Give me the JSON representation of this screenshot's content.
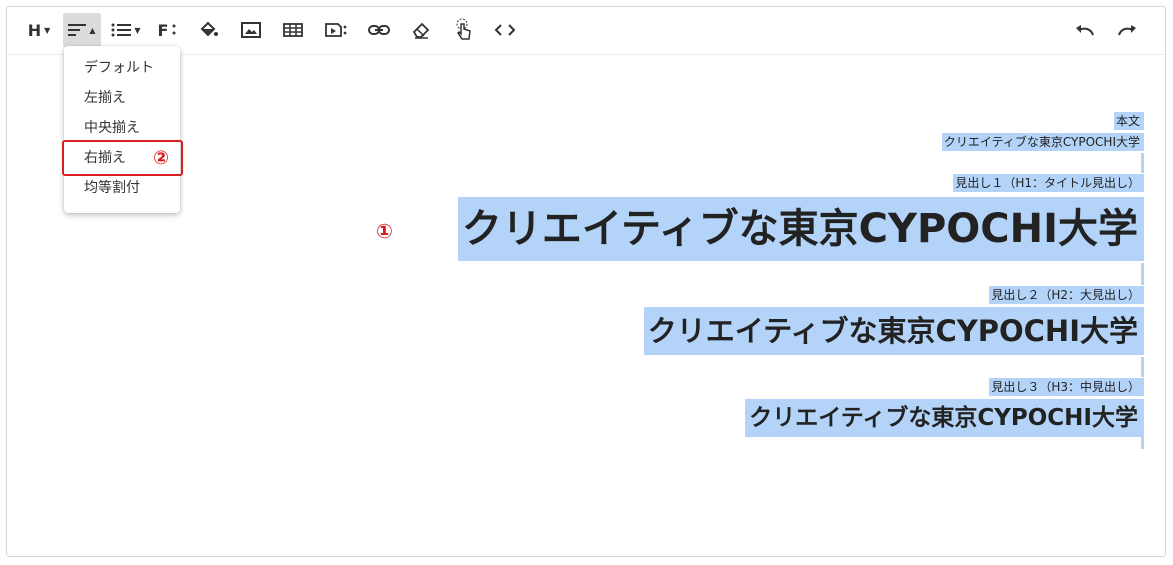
{
  "toolbar": {
    "heading_label": "H",
    "font_label": "F",
    "buttons": [
      {
        "icon": "heading-icon"
      },
      {
        "icon": "align-icon"
      },
      {
        "icon": "list-icon"
      },
      {
        "icon": "font-icon"
      },
      {
        "icon": "fill-color-icon"
      },
      {
        "icon": "image-icon"
      },
      {
        "icon": "table-icon"
      },
      {
        "icon": "media-icon"
      },
      {
        "icon": "link-icon"
      },
      {
        "icon": "eraser-icon"
      },
      {
        "icon": "touch-icon"
      },
      {
        "icon": "code-icon"
      },
      {
        "icon": "undo-icon"
      },
      {
        "icon": "redo-icon"
      }
    ]
  },
  "align_menu": {
    "items": [
      "デフォルト",
      "左揃え",
      "中央揃え",
      "右揃え",
      "均等割付"
    ],
    "highlighted_index": 3
  },
  "markers": {
    "one": "①",
    "two": "②"
  },
  "content": {
    "body_label": "本文",
    "body_text": "クリエイティブな東京CYPOCHI大学",
    "h1_label": "見出し１（H1：タイトル見出し）",
    "h1_text": "クリエイティブな東京CYPOCHI大学",
    "h2_label": "見出し２（H2：大見出し）",
    "h2_text": "クリエイティブな東京CYPOCHI大学",
    "h3_label": "見出し３（H3：中見出し）",
    "h3_text": "クリエイティブな東京CYPOCHI大学"
  },
  "colors": {
    "selection": "#b3d4f8",
    "marker_red": "#d81e1e",
    "active_button": "#dcdcdc"
  }
}
